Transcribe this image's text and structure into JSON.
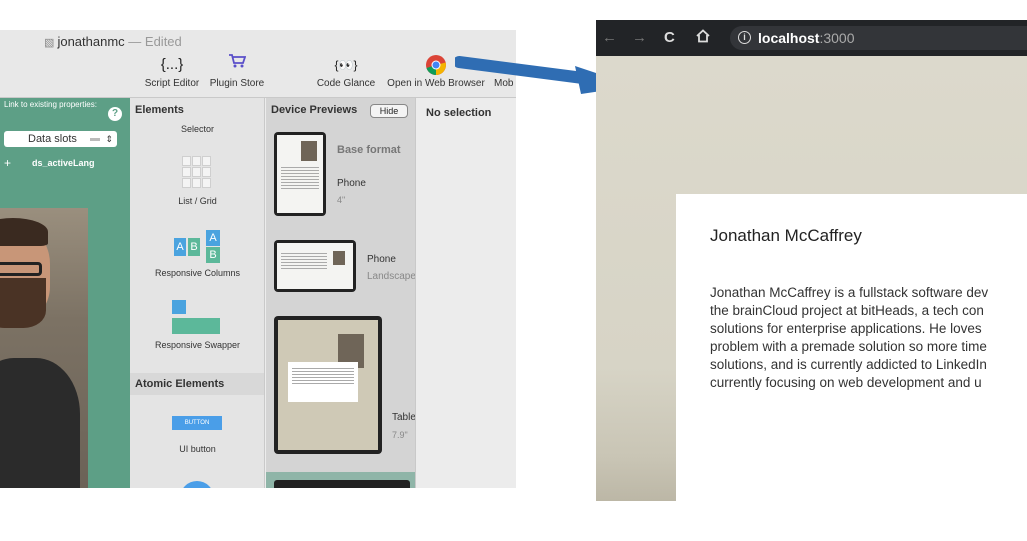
{
  "app": {
    "document_name": "jonathanmc",
    "edited_suffix": "— Edited",
    "toolbar": [
      {
        "label": "Script Editor",
        "icon": "{...}"
      },
      {
        "label": "Plugin Store",
        "icon": "cart-icon"
      },
      {
        "label": "Code Glance",
        "icon": "{👀}"
      },
      {
        "label": "Open in Web Browser",
        "icon": "chrome-icon"
      },
      {
        "label": "Mob",
        "icon": ""
      }
    ],
    "props_panel": {
      "header": "Link to existing properties:",
      "slots_value": "Data slots",
      "slot_item": "ds_activeLang",
      "add_symbol": "+"
    },
    "elements": {
      "title": "Elements",
      "items": [
        "Selector",
        "List / Grid",
        "Responsive Columns",
        "Responsive Swapper"
      ],
      "atomic_title": "Atomic Elements",
      "button_text": "BUTTON",
      "ui_button_label": "UI button"
    },
    "previews": {
      "title": "Device Previews",
      "hide_label": "Hide",
      "devices": [
        {
          "name": "Base format",
          "type": "Phone",
          "size": "4\""
        },
        {
          "name": "Phone",
          "type": "Landscape",
          "size": ""
        },
        {
          "name": "Table",
          "type": "",
          "size": "7.9\""
        }
      ]
    },
    "inspector": {
      "title": "No selection"
    }
  },
  "browser": {
    "url_host": "localhost",
    "url_port": ":3000",
    "card": {
      "title": "Jonathan McCaffrey",
      "lines": [
        "Jonathan McCaffrey is a fullstack software dev",
        "the brainCloud project at bitHeads, a tech con",
        "solutions for enterprise applications. He loves",
        "problem with a premade solution so more time",
        "solutions, and is currently addicted to LinkedIn",
        "currently focusing on web development and u"
      ]
    }
  },
  "colors": {
    "accent_green": "#5d9f86",
    "arrow_blue": "#2f6db3",
    "button_blue": "#4a9ee8"
  }
}
